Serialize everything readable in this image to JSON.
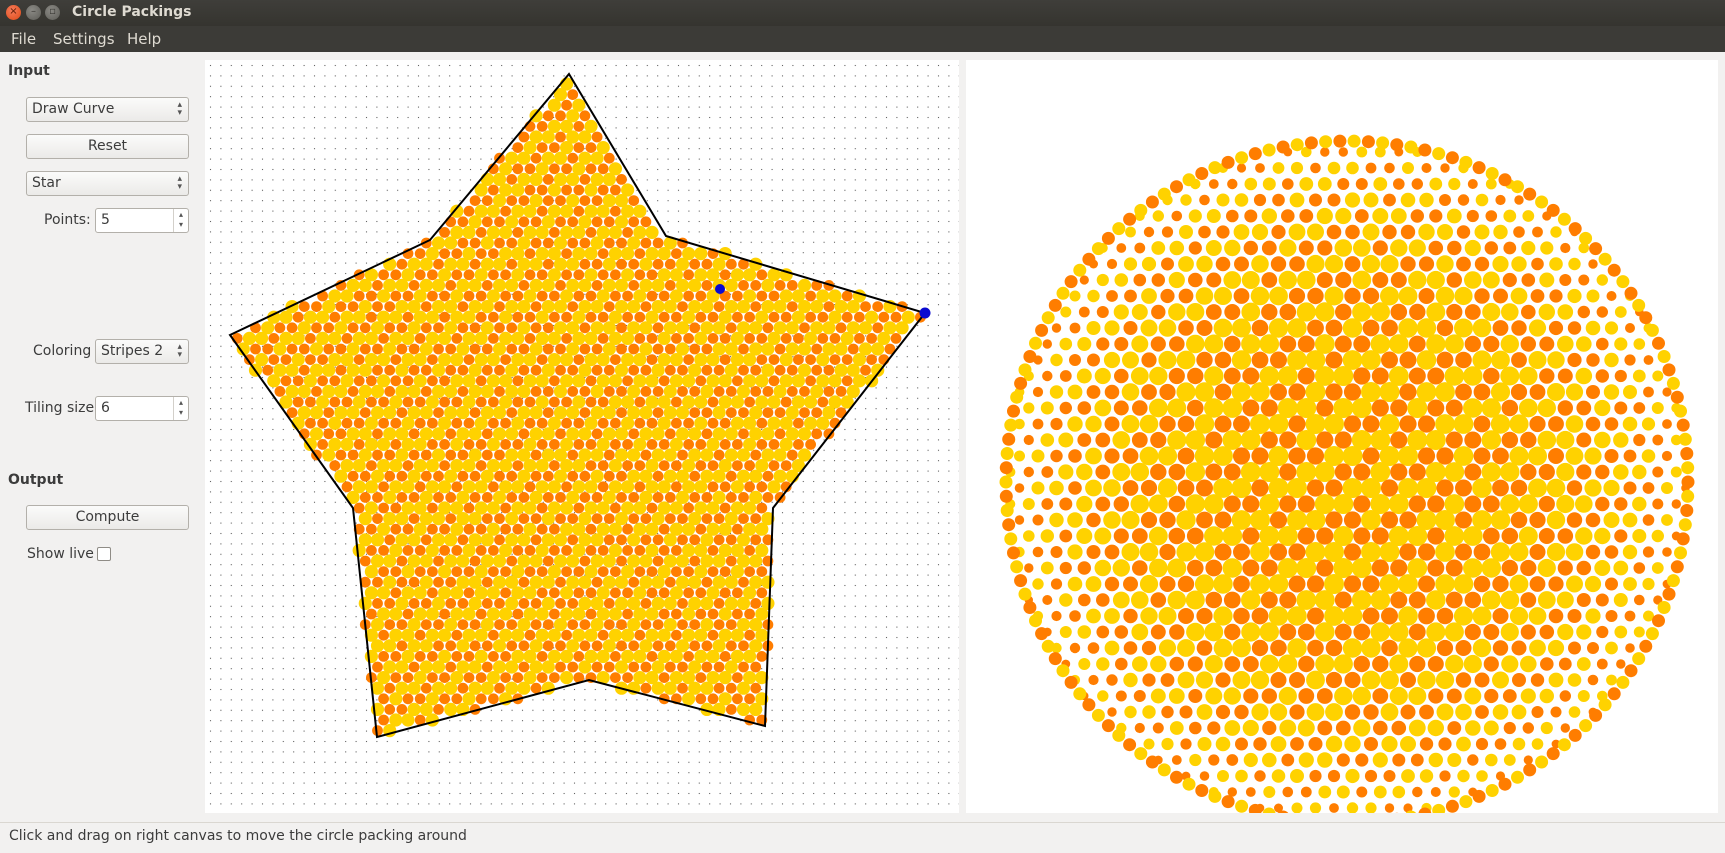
{
  "window": {
    "title": "Circle Packings",
    "close_glyph": "×",
    "min_glyph": "–",
    "max_glyph": "▫"
  },
  "menu": {
    "file": "File",
    "settings": "Settings",
    "help": "Help"
  },
  "input": {
    "heading": "Input",
    "mode": "Draw Curve",
    "reset_label": "Reset",
    "shape": "Star",
    "points_label": "Points:",
    "points_value": "5",
    "coloring_label": "Coloring",
    "coloring_value": "Stripes 2",
    "tiling_label": "Tiling size",
    "tiling_value": "6"
  },
  "output": {
    "heading": "Output",
    "compute_label": "Compute",
    "show_live_label": "Show live",
    "show_live_checked": false
  },
  "status": {
    "text": "Click and drag on right canvas to move the circle packing around"
  },
  "icons": {
    "combo_arrows": "▴▾",
    "spin_up": "▴",
    "spin_down": "▾"
  },
  "colors": {
    "fill_yellow": "#ffd200",
    "fill_orange": "#ff7d00",
    "curve": "#000000",
    "handle": "#0a0ad0"
  }
}
